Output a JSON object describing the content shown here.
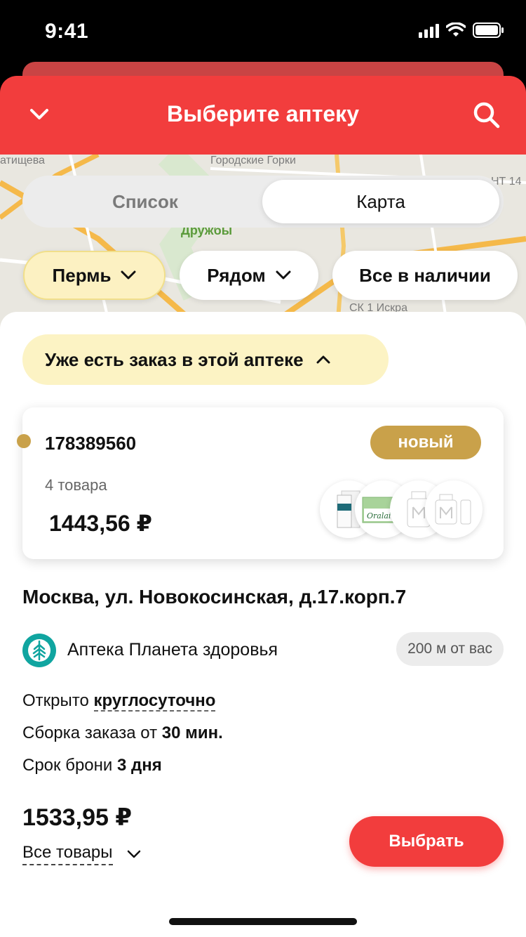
{
  "status_bar": {
    "time": "9:41"
  },
  "header": {
    "title": "Выберите аптеку"
  },
  "map_labels": [
    "атищева",
    "Городские Горки",
    "Дружбы",
    "СК 1 Искра",
    "НТ 14"
  ],
  "segment": {
    "list_label": "Список",
    "map_label": "Карта",
    "selected": "map"
  },
  "filters": {
    "city": "Пермь",
    "nearby": "Рядом",
    "stock": "Все в наличии"
  },
  "order_section": {
    "toggle_label": "Уже есть заказ в этой аптеке"
  },
  "order": {
    "number": "178389560",
    "status": "новый",
    "items_count": "4 товара",
    "sum": "1443,56 ₽",
    "thumb_text": "Oralair"
  },
  "pharmacy": {
    "address": "Москва, ул. Новокосинская, д.17.корп.7",
    "name": "Аптека Планета здоровья",
    "distance": "200 м от вас",
    "open_prefix": "Открыто ",
    "open_value": "круглосуточно",
    "assembly_prefix": "Сборка заказа от ",
    "assembly_value": "30 мин.",
    "reserve_prefix": "Срок брони ",
    "reserve_value": "3 дня"
  },
  "footer": {
    "total": "1533,95 ₽",
    "all_goods_label": "Все товары",
    "choose_label": "Выбрать"
  },
  "colors": {
    "brand_red": "#f23d3d",
    "badge_gold": "#c9a14a",
    "chip_yellow": "#fcf1c2",
    "pharmacy_teal": "#10a5a0"
  }
}
